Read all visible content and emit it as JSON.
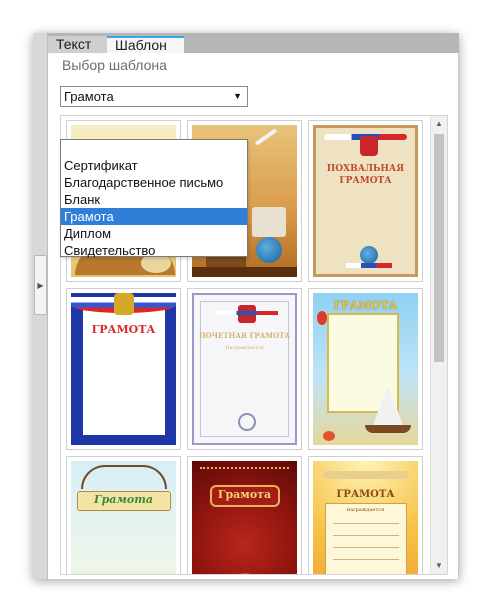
{
  "tabs": [
    {
      "label": "Текст",
      "active": false
    },
    {
      "label": "Шаблон",
      "active": true
    }
  ],
  "section_title": "Выбор шаблона",
  "template_select": {
    "selected": "Грамота",
    "options": [
      "Сертификат",
      "Благодарственное письмо",
      "Бланк",
      "Грамота",
      "Диплом",
      "Свидетельство"
    ]
  },
  "thumbnails": [
    {
      "name": "Scholar with books"
    },
    {
      "name": "Pharaoh and globe"
    },
    {
      "name": "Похвальная грамота",
      "title_top": "ПОХВАЛЬНАЯ",
      "title_bottom": "ГРАМОТА"
    },
    {
      "name": "Грамота tricolor",
      "title": "ГРАМОТА"
    },
    {
      "name": "Почетная грамота",
      "title": "ПОЧЕТНАЯ ГРАМОТА",
      "subtitle": "Награждается"
    },
    {
      "name": "Грамота sea",
      "title": "ГРАМОТА"
    },
    {
      "name": "Грамота tea",
      "title": "Грамота"
    },
    {
      "name": "Грамота red",
      "title": "Грамота"
    },
    {
      "name": "Грамота sun",
      "title": "ГРАМОТА",
      "subtitle": "награждается"
    }
  ],
  "colors": {
    "accent": "#3aa7e6",
    "selection": "#2f7fd9",
    "frame": "#c9c9c9"
  }
}
